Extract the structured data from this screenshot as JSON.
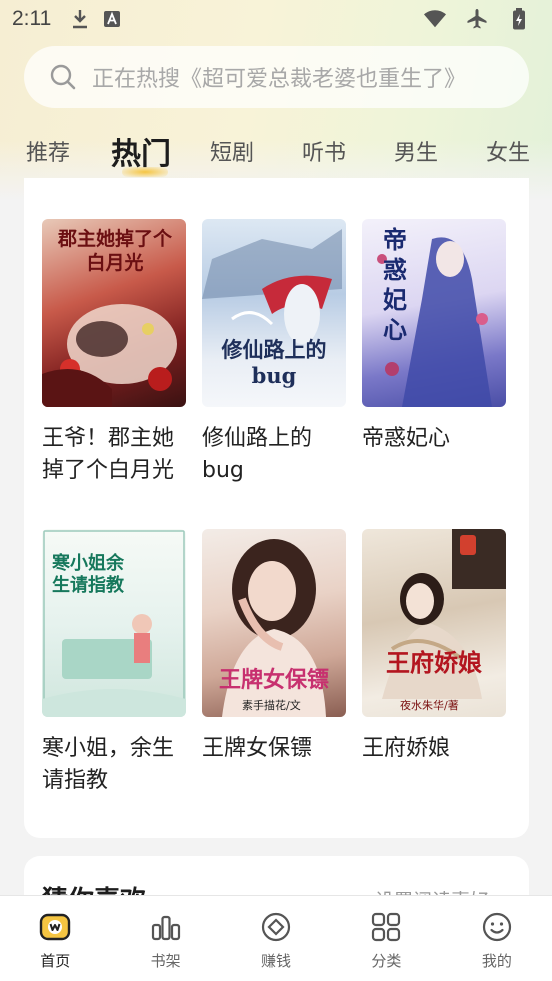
{
  "status_bar": {
    "time": "2:11"
  },
  "search": {
    "placeholder": "正在热搜《超可爱总裁老婆也重生了》"
  },
  "tabs": [
    {
      "label": "推荐"
    },
    {
      "label": "热门",
      "active": true
    },
    {
      "label": "短剧"
    },
    {
      "label": "听书"
    },
    {
      "label": "男生"
    },
    {
      "label": "女生"
    }
  ],
  "books": [
    {
      "title": "王爷！郡主她掉了个白月光",
      "cover_text": "郡主她掉了个白月光"
    },
    {
      "title": "修仙路上的bug",
      "cover_text": "修仙路上的bug"
    },
    {
      "title": "帝惑妃心",
      "cover_text": "帝惑妃心"
    },
    {
      "title": "寒小姐，余生请指教",
      "cover_text": "寒小姐余生请指教"
    },
    {
      "title": "王牌女保镖",
      "cover_text": "王牌女保镖",
      "cover_author": "素手描花/文"
    },
    {
      "title": "王府娇娘",
      "cover_text": "王府娇娘",
      "cover_author": "夜水朱华/著"
    }
  ],
  "recommend": {
    "title": "猜你喜欢",
    "link": "设置阅读喜好 >"
  },
  "nav": [
    {
      "label": "首页",
      "icon": "home-icon",
      "active": true
    },
    {
      "label": "书架",
      "icon": "bookshelf-icon"
    },
    {
      "label": "赚钱",
      "icon": "earn-icon"
    },
    {
      "label": "分类",
      "icon": "category-icon"
    },
    {
      "label": "我的",
      "icon": "profile-icon"
    }
  ],
  "colors": {
    "accent": "#f5c542",
    "text": "#222222"
  }
}
